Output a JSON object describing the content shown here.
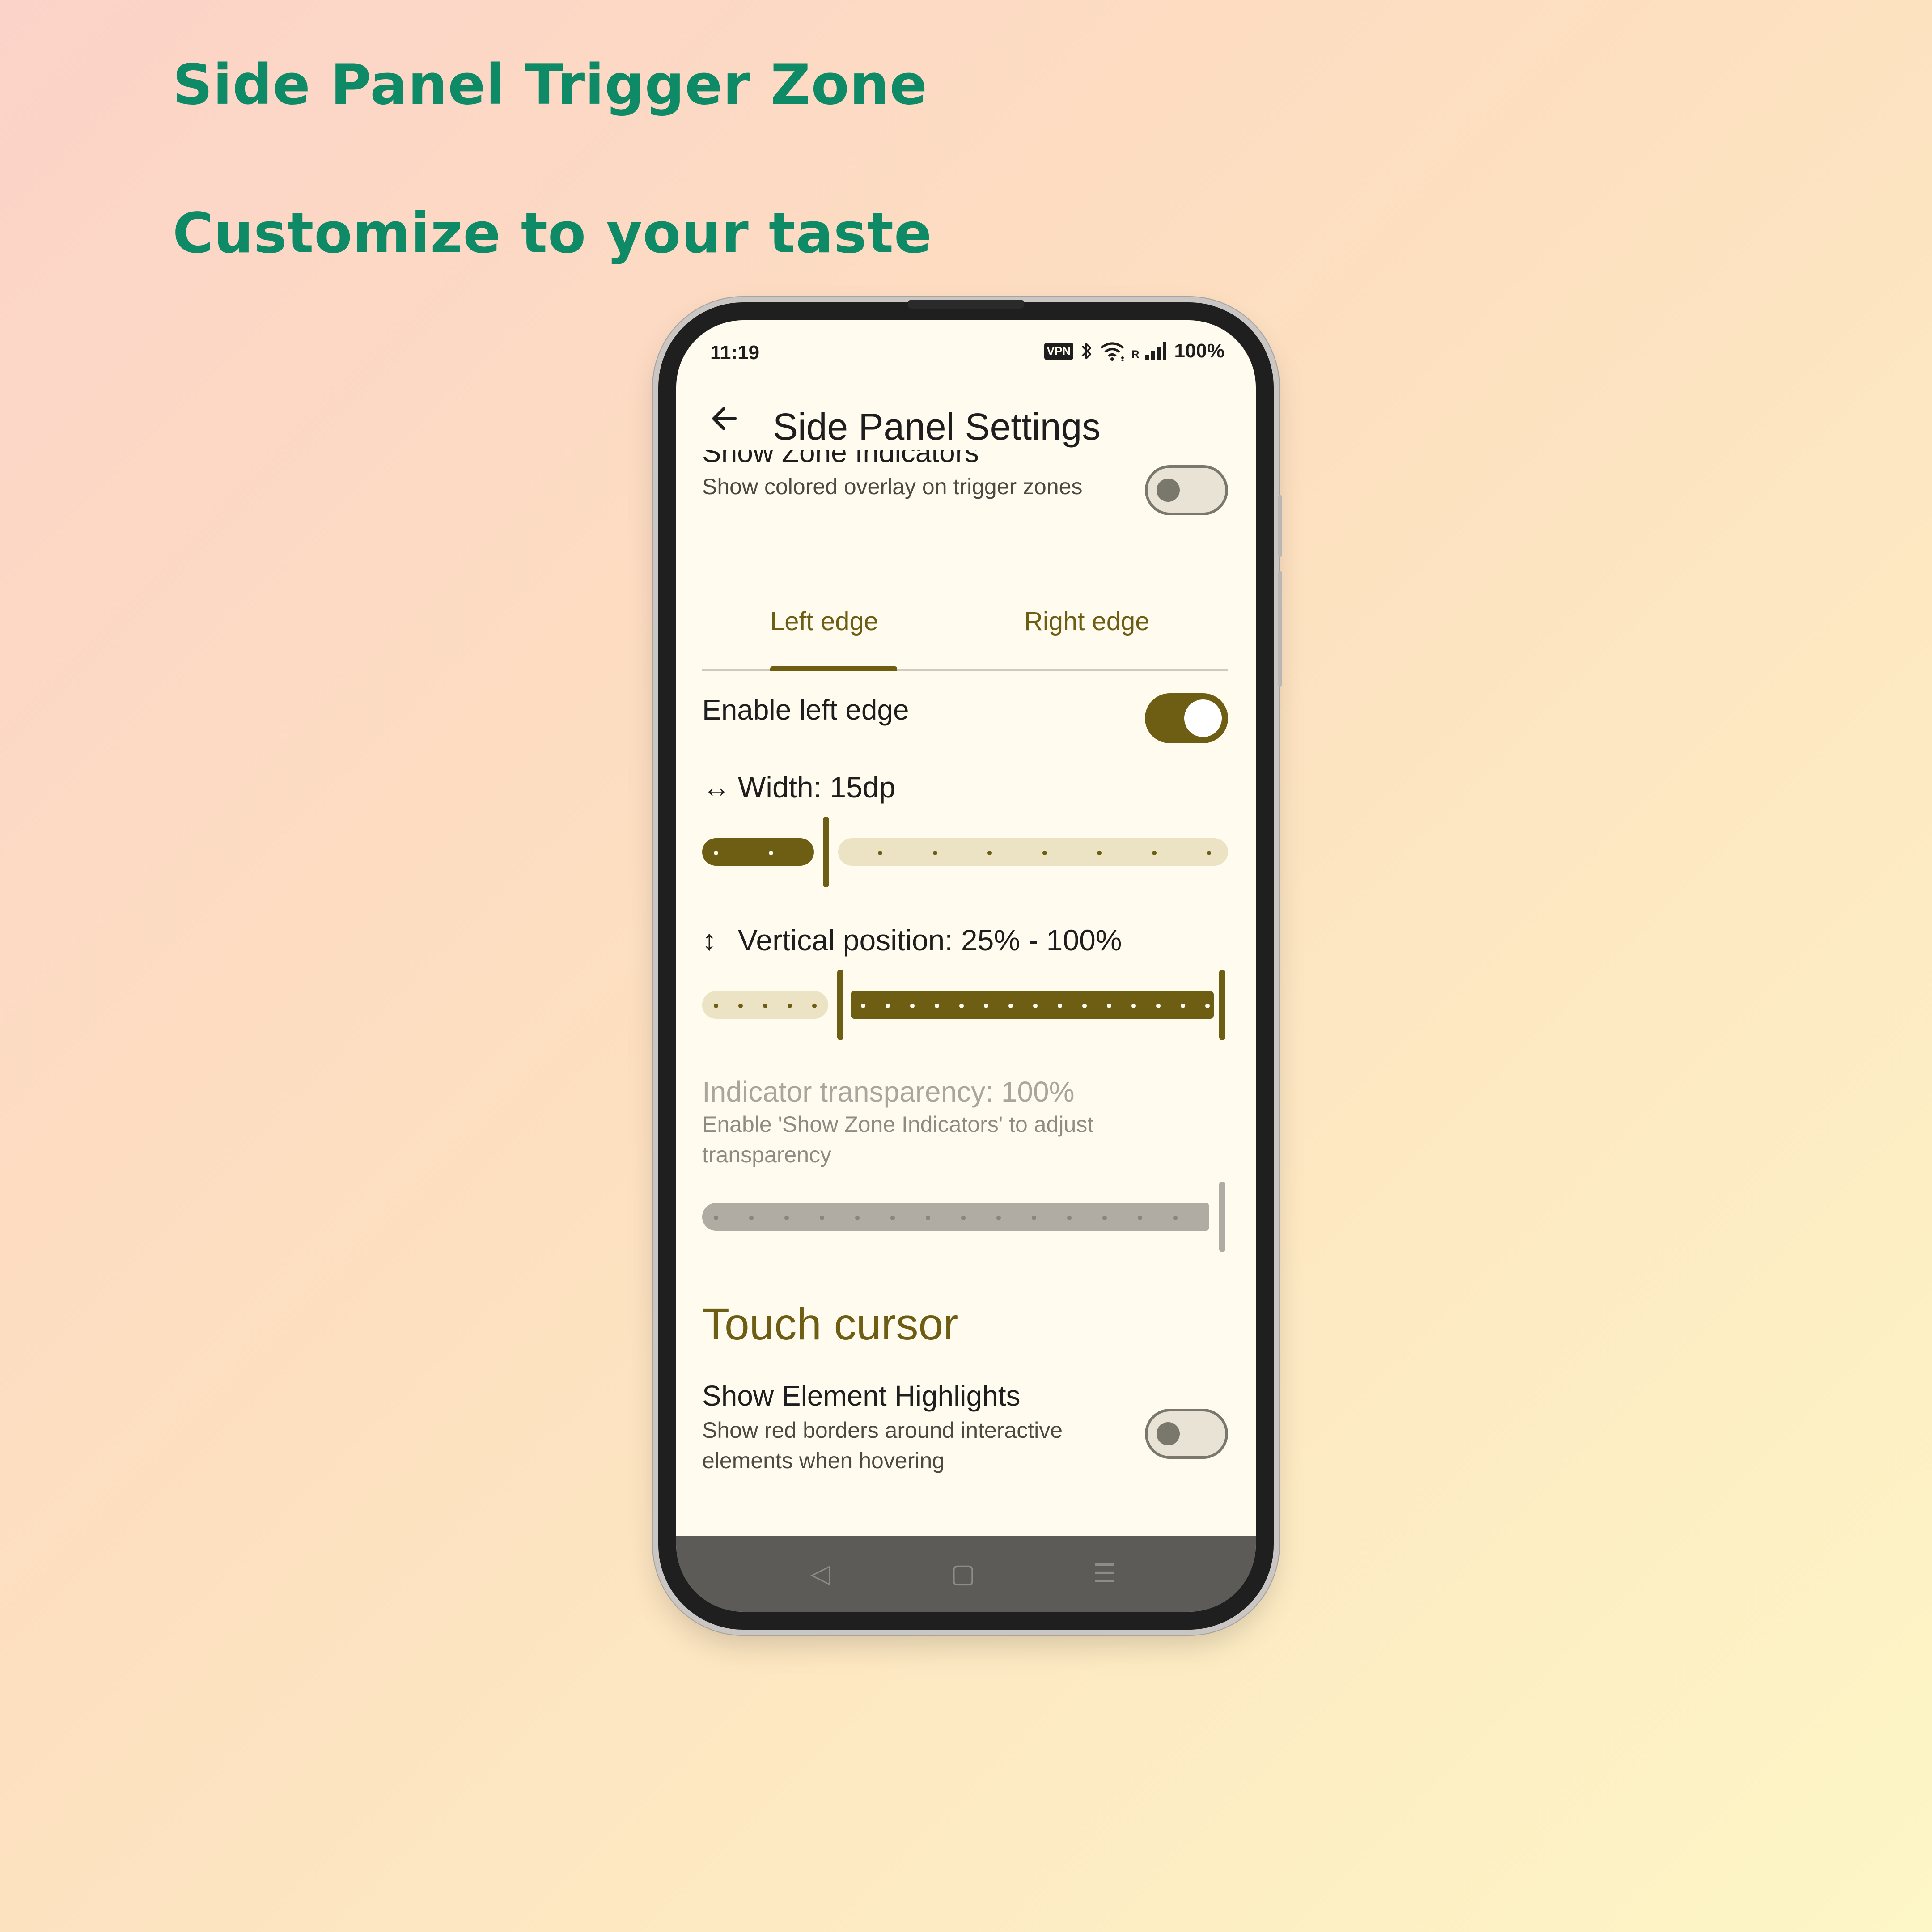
{
  "promo": {
    "title": "Side Panel Trigger Zone",
    "subtitle": "Customize to your taste"
  },
  "status_bar": {
    "time": "11:19",
    "vpn_label": "VPN",
    "roaming_label": "R",
    "battery": "100%",
    "icons": [
      "vpn-icon",
      "bluetooth-icon",
      "wifi-icon",
      "signal-icon"
    ]
  },
  "app_bar": {
    "back_icon": "arrow-left-icon",
    "title": "Side Panel Settings"
  },
  "show_zone_indicators": {
    "title": "Show Zone Indicators",
    "subtitle": "Show colored overlay on trigger zones",
    "enabled": false
  },
  "tabs": {
    "items": [
      "Left edge",
      "Right edge"
    ],
    "selected_index": 0
  },
  "enable_left_edge": {
    "title": "Enable left edge",
    "enabled": true
  },
  "width": {
    "label": "Width: 15dp",
    "icon": "horizontal-arrows-icon",
    "slider_steps": 10,
    "value_step": 2
  },
  "vertical_position": {
    "label": "Vertical position: 25% - 100%",
    "icon": "vertical-arrows-icon",
    "range_start": 0.25,
    "range_end": 1.0
  },
  "indicator_transparency": {
    "label": "Indicator transparency: 100%",
    "hint": "Enable 'Show Zone Indicators' to adjust transparency",
    "value": 1.0,
    "disabled": true
  },
  "touch_cursor": {
    "section_title": "Touch cursor",
    "show_element_highlights": {
      "title": "Show Element Highlights",
      "subtitle": "Show red borders around interactive elements when hovering",
      "enabled": false
    }
  },
  "nav_bar": {
    "back": "◁",
    "home": "▢",
    "menu": "☰"
  },
  "colors": {
    "accent": "#6e5e14",
    "promo_text": "#0e8a66",
    "screen_bg": "#fffbef"
  }
}
